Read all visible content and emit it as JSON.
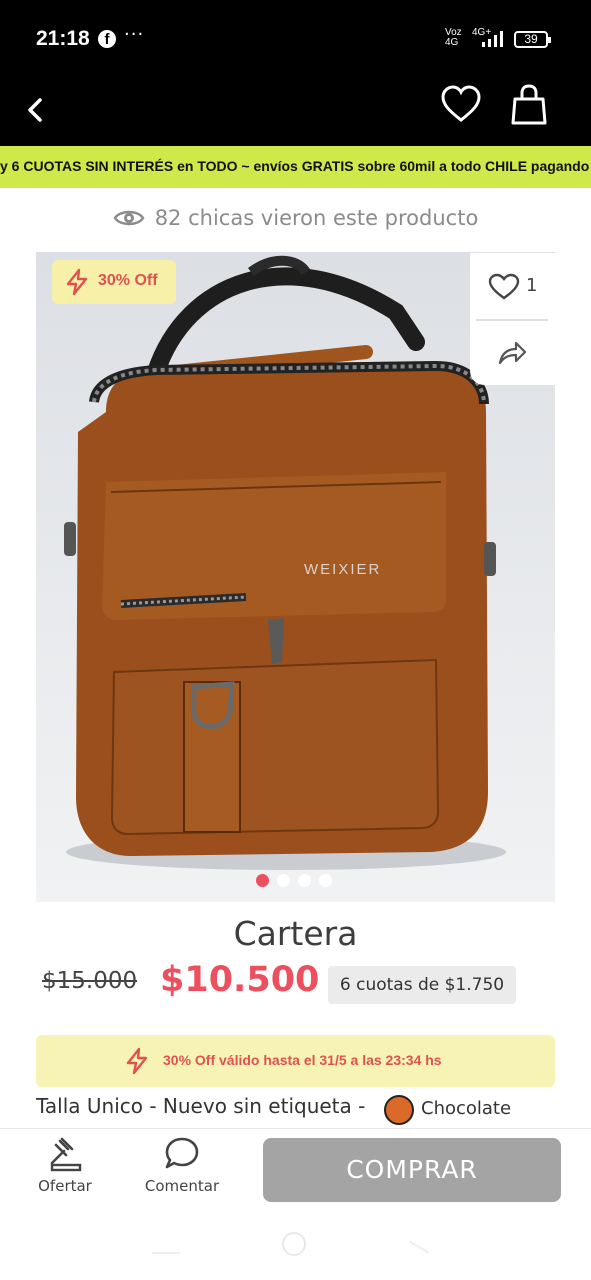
{
  "status_bar": {
    "time": "21:18",
    "notification_icons": [
      "facebook-icon",
      "more-notifications-icon"
    ],
    "network_type_1": "Voz 4G",
    "network_type_2": "4G+",
    "battery_level": "39"
  },
  "header": {
    "icons": [
      "back-arrow-icon",
      "heart-icon",
      "shopping-bag-icon"
    ]
  },
  "promo_banner": {
    "text": "y 6 CUOTAS SIN INTERÉS en TODO ~ envíos GRATIS sobre 60mil a todo CHILE pagando"
  },
  "viewers": {
    "text": "82 chicas vieron este producto"
  },
  "product_image": {
    "discount_badge": "30% Off",
    "likes": "1",
    "carousel_total": 4,
    "carousel_active": 0
  },
  "product": {
    "title": "Cartera",
    "old_price": "$15.000",
    "new_price": "$10.500",
    "installments": "6 cuotas de $1.750",
    "offer_note": "30% Off válido hasta el 31/5 a las 23:34 hs",
    "details": "Talla Unico - Nuevo sin etiqueta -",
    "color_name": "Chocolate",
    "color_hex": "#d96a2a"
  },
  "bottom_bar": {
    "offer_label": "Ofertar",
    "comment_label": "Comentar",
    "buy_label": "COMPRAR"
  },
  "colors": {
    "accent_green": "#cfe84a",
    "price_red": "#ec4f5d",
    "badge_yellow": "#f7f0a8",
    "buy_button_gray": "#a4a4a4"
  }
}
